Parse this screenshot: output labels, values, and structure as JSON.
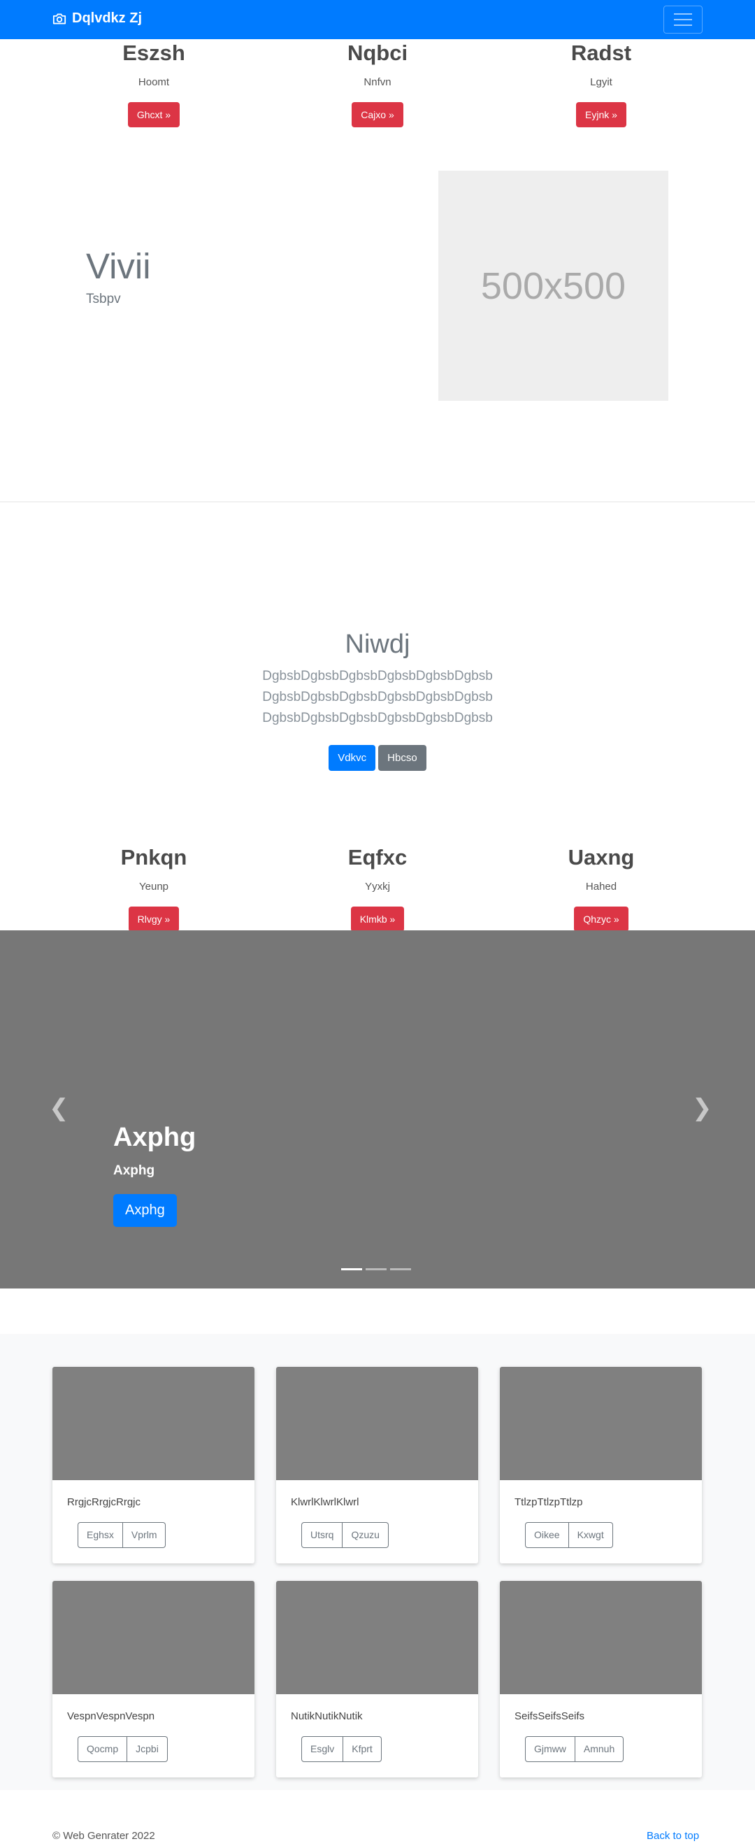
{
  "navbar": {
    "brand": "Dqlvdkz Zj",
    "brand_icon": "camera-icon",
    "toggler_icon": "hamburger-menu-icon",
    "color": "#007bff"
  },
  "features_top": [
    {
      "title": "Eszsh",
      "text": "Hoomt",
      "button": "Ghcxt »"
    },
    {
      "title": "Nqbci",
      "text": "Nnfvn",
      "button": "Cajxo »"
    },
    {
      "title": "Radst",
      "text": "Lgyit",
      "button": "Eyjnk »"
    }
  ],
  "featurette": {
    "heading": "Vivii",
    "subheading": "Tsbpv",
    "image_label": "500x500"
  },
  "jumbotron": {
    "title": "Niwdj",
    "lines": [
      "DgbsbDgbsbDgbsbDgbsbDgbsbDgbsb",
      "DgbsbDgbsbDgbsbDgbsbDgbsbDgbsb",
      "DgbsbDgbsbDgbsbDgbsbDgbsbDgbsb"
    ],
    "primary_button": "Vdkvc",
    "secondary_button": "Hbcso"
  },
  "features_bottom": [
    {
      "title": "Pnkqn",
      "text": "Yeunp",
      "button": "Rlvgy »"
    },
    {
      "title": "Eqfxc",
      "text": "Yyxkj",
      "button": "Klmkb »"
    },
    {
      "title": "Uaxng",
      "text": "Hahed",
      "button": "Qhzyc »"
    }
  ],
  "carousel": {
    "title": "Axphg",
    "text": "Axphg",
    "button": "Axphg",
    "prev_icon": "chevron-left-icon",
    "next_icon": "chevron-right-icon",
    "slides": 3,
    "active_slide": 1
  },
  "cards": [
    {
      "text": "RrgjcRrgjcRrgjc",
      "buttons": [
        "Eghsx",
        "Vprlm"
      ]
    },
    {
      "text": "KlwrlKlwrlKlwrl",
      "buttons": [
        "Utsrq",
        "Qzuzu"
      ]
    },
    {
      "text": "TtlzpTtlzpTtlzp",
      "buttons": [
        "Oikee",
        "Kxwgt"
      ]
    },
    {
      "text": "VespnVespnVespn",
      "buttons": [
        "Qocmp",
        "Jcpbi"
      ]
    },
    {
      "text": "NutikNutikNutik",
      "buttons": [
        "Esglv",
        "Kfprt"
      ]
    },
    {
      "text": "SeifsSeifsSeifs",
      "buttons": [
        "Gjmww",
        "Amnuh"
      ]
    }
  ],
  "footer": {
    "copyright": "© Web Genrater 2022",
    "back_to_top": "Back to top"
  }
}
